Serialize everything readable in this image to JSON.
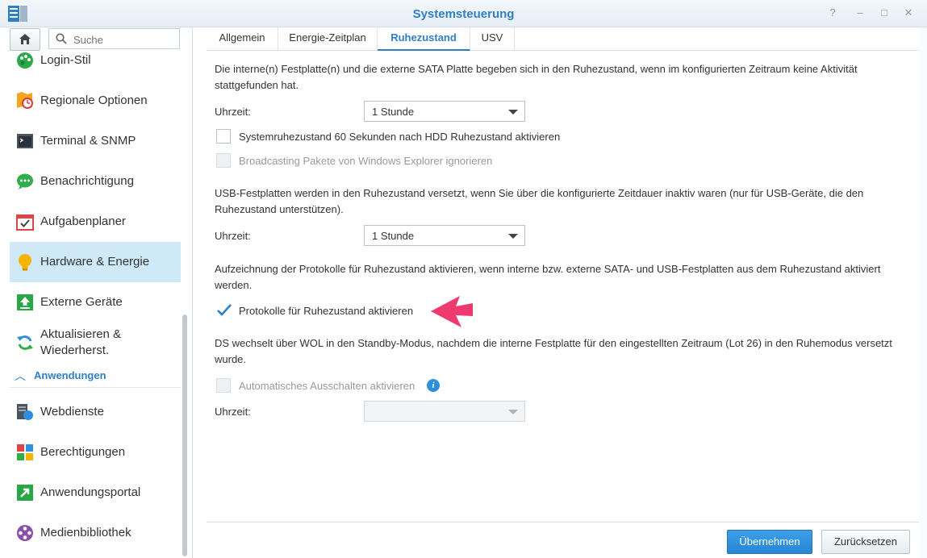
{
  "window": {
    "title": "Systemsteuerung",
    "help_icon": "?",
    "minimize_icon": "–",
    "maximize_icon": "□",
    "close_icon": "✕"
  },
  "search": {
    "placeholder": "Suche"
  },
  "sidebar": {
    "items": [
      {
        "label": "Login-Stil",
        "icon": "palette-icon"
      },
      {
        "label": "Regionale Optionen",
        "icon": "regional-icon"
      },
      {
        "label": "Terminal & SNMP",
        "icon": "terminal-icon"
      },
      {
        "label": "Benachrichtigung",
        "icon": "chat-icon"
      },
      {
        "label": "Aufgabenplaner",
        "icon": "calendar-check-icon"
      },
      {
        "label": "Hardware & Energie",
        "icon": "lightbulb-icon",
        "active": true
      },
      {
        "label": "Externe Geräte",
        "icon": "upload-icon"
      },
      {
        "label": "Aktualisieren &",
        "label2": "Wiederherst.",
        "icon": "refresh-icon"
      }
    ],
    "section_header": "Anwendungen",
    "apps": [
      {
        "label": "Webdienste",
        "icon": "web-services-icon"
      },
      {
        "label": "Berechtigungen",
        "icon": "permissions-icon"
      },
      {
        "label": "Anwendungsportal",
        "icon": "portal-icon"
      },
      {
        "label": "Medienbibliothek",
        "icon": "media-icon"
      }
    ]
  },
  "tabs": [
    "Allgemein",
    "Energie-Zeitplan",
    "Ruhezustand",
    "USV"
  ],
  "content": {
    "hdd_text": "Die interne(n) Festplatte(n) und die externe SATA Platte begeben sich in den Ruhezustand, wenn im konfigurierten Zeitraum keine Aktivität stattgefunden hat.",
    "time_label": "Uhrzeit:",
    "hdd_select": "1 Stunde",
    "system_sleep_label": "Systemruhezustand 60 Sekunden nach HDD Ruhezustand aktivieren",
    "broadcast_label": "Broadcasting Pakete von Windows Explorer ignorieren",
    "usb_text": "USB-Festplatten werden in den Ruhezustand versetzt, wenn Sie über die konfigurierte Zeitdauer inaktiv waren (nur für USB-Geräte, die den Ruhezustand unterstützen).",
    "usb_select": "1 Stunde",
    "log_text": "Aufzeichnung der Protokolle für Ruhezustand aktivieren, wenn interne bzw. externe SATA- und USB-Festplatten aus dem Ruhezustand aktiviert werden.",
    "log_label": "Protokolle für Ruhezustand aktivieren",
    "wol_text": "DS wechselt über WOL in den Standby-Modus, nachdem die interne Festplatte für den eingestellten Zeitraum (Lot 26) in den Ruhemodus versetzt wurde.",
    "auto_off_label": "Automatisches Ausschalten aktivieren",
    "wol_select": ""
  },
  "footer": {
    "apply": "Übernehmen",
    "reset": "Zurücksetzen"
  },
  "colors": {
    "accent": "#2f7fc6",
    "active_bg": "#d0e9f8",
    "arrow": "#ee3a6e"
  }
}
